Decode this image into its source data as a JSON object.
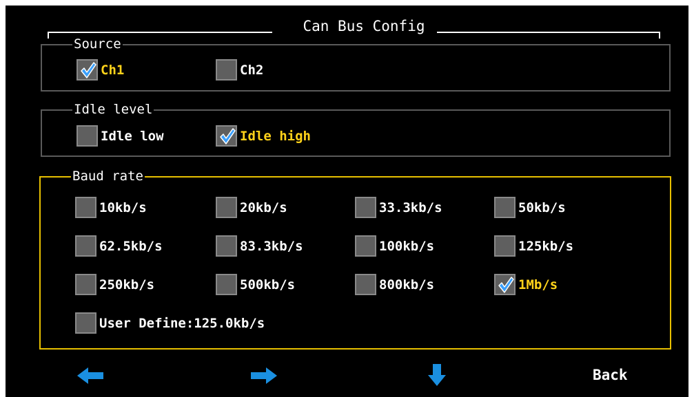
{
  "title": "Can Bus Config",
  "colors": {
    "background": "#000000",
    "active_border": "#e8c000",
    "selected_text": "#ffd21a",
    "arrow": "#1a8fe0"
  },
  "source": {
    "legend": "Source",
    "options": [
      {
        "label": "Ch1",
        "checked": true
      },
      {
        "label": "Ch2",
        "checked": false
      }
    ]
  },
  "idle_level": {
    "legend": "Idle level",
    "options": [
      {
        "label": "Idle low",
        "checked": false
      },
      {
        "label": "Idle high",
        "checked": true
      }
    ]
  },
  "baud_rate": {
    "legend": "Baud rate",
    "options": [
      {
        "label": "10kb/s",
        "checked": false
      },
      {
        "label": "20kb/s",
        "checked": false
      },
      {
        "label": "33.3kb/s",
        "checked": false
      },
      {
        "label": "50kb/s",
        "checked": false
      },
      {
        "label": "62.5kb/s",
        "checked": false
      },
      {
        "label": "83.3kb/s",
        "checked": false
      },
      {
        "label": "100kb/s",
        "checked": false
      },
      {
        "label": "125kb/s",
        "checked": false
      },
      {
        "label": "250kb/s",
        "checked": false
      },
      {
        "label": "500kb/s",
        "checked": false
      },
      {
        "label": "800kb/s",
        "checked": false
      },
      {
        "label": "1Mb/s",
        "checked": true
      },
      {
        "label": "User Define:125.0kb/s",
        "checked": false
      }
    ]
  },
  "footer": {
    "left_icon": "arrow-left-icon",
    "right_icon": "arrow-right-icon",
    "down_icon": "arrow-down-icon",
    "back_label": "Back"
  }
}
